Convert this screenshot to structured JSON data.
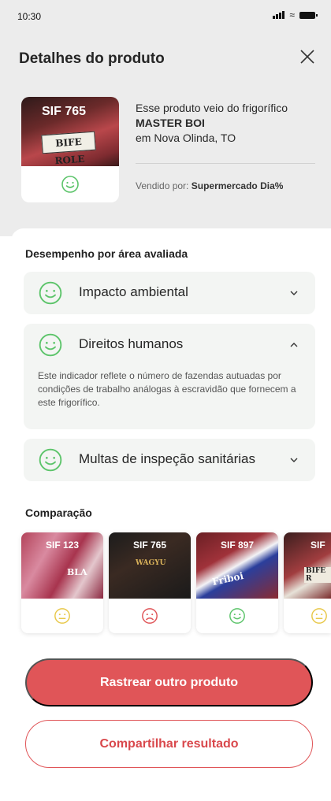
{
  "status_bar": {
    "time": "10:30"
  },
  "header": {
    "title": "Detalhes do produto"
  },
  "product": {
    "sif": "SIF 765",
    "package_label": "BIFE ROLE",
    "origin_line1": "Esse produto veio do frigorífico",
    "plant_name": "MASTER BOI",
    "location": "em Nova Olinda, TO",
    "seller_prefix": "Vendido por: ",
    "seller_name": "Supermercado Dia%",
    "rating": "good"
  },
  "performance": {
    "heading": "Desempenho por área avaliada",
    "areas": [
      {
        "label": "Impacto ambiental",
        "rating": "good",
        "expanded": false
      },
      {
        "label": "Direitos humanos",
        "rating": "good",
        "expanded": true,
        "description": "Este indicador reflete o número de fazendas autuadas por condições de trabalho análogas à escravidão que fornecem a este frigorífico."
      },
      {
        "label": "Multas de inspeção sanitárias",
        "rating": "good",
        "expanded": false
      }
    ]
  },
  "comparison": {
    "heading": "Comparação",
    "items": [
      {
        "sif": "SIF 123",
        "rating": "neutral",
        "tag": "BLA"
      },
      {
        "sif": "SIF 765",
        "rating": "bad",
        "tag": "WAGYU"
      },
      {
        "sif": "SIF 897",
        "rating": "good",
        "tag": "Friboi"
      },
      {
        "sif": "SIF",
        "rating": "neutral",
        "tag": "BIFE R"
      }
    ]
  },
  "actions": {
    "primary": "Rastrear outro produto",
    "secondary": "Compartilhar resultado"
  },
  "colors": {
    "good": "#5cc46a",
    "neutral": "#e8c84a",
    "bad": "#e05558",
    "accent": "#e05558",
    "background_top": "#ececec"
  },
  "icons": {
    "close": "close-icon",
    "chevron_down": "chevron-down-icon",
    "chevron_up": "chevron-up-icon",
    "good_face": "smile-icon",
    "neutral_face": "neutral-face-icon",
    "bad_face": "sad-face-icon"
  }
}
